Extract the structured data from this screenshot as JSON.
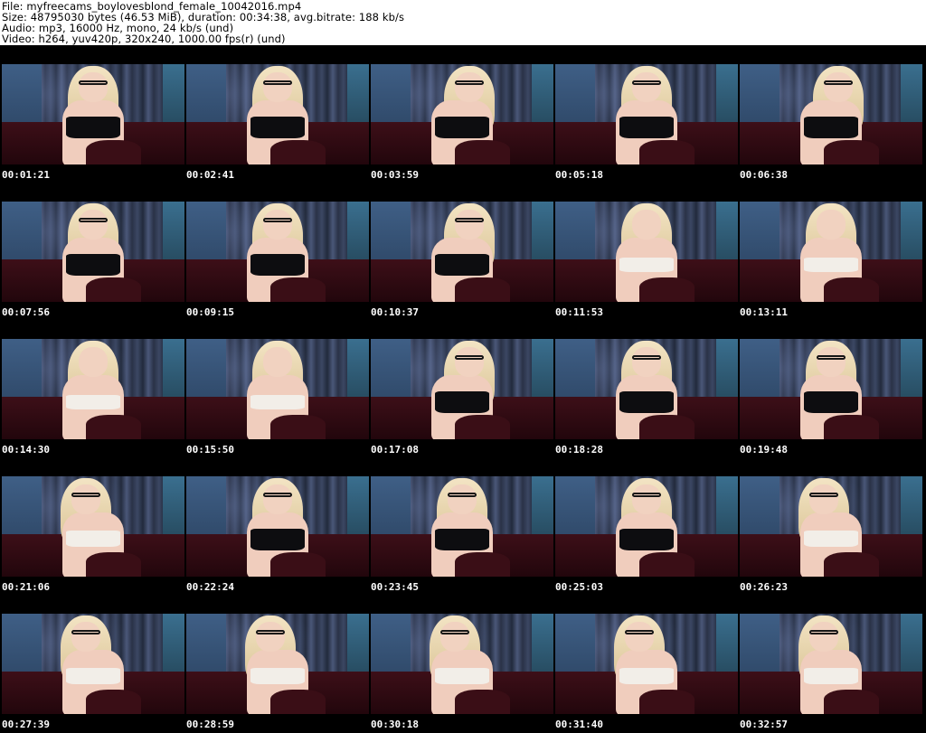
{
  "header": {
    "file_line": "File: myfreecams_boylovesblond_female_10042016.mp4",
    "size_line": "Size: 48795030 bytes (46.53 MiB), duration: 00:34:38, avg.bitrate: 188 kb/s",
    "audio_line": "Audio: mp3, 16000 Hz, mono, 24 kb/s (und)",
    "video_line": "Video: h264, yuv420p, 320x240, 1000.00 fps(r) (und)"
  },
  "frames": [
    {
      "timestamp": "00:01:21",
      "pose": "a"
    },
    {
      "timestamp": "00:02:41",
      "pose": "a"
    },
    {
      "timestamp": "00:03:59",
      "pose": "b"
    },
    {
      "timestamp": "00:05:18",
      "pose": "a"
    },
    {
      "timestamp": "00:06:38",
      "pose": "b"
    },
    {
      "timestamp": "00:07:56",
      "pose": "a"
    },
    {
      "timestamp": "00:09:15",
      "pose": "a"
    },
    {
      "timestamp": "00:10:37",
      "pose": "b"
    },
    {
      "timestamp": "00:11:53",
      "pose": "d"
    },
    {
      "timestamp": "00:13:11",
      "pose": "d"
    },
    {
      "timestamp": "00:14:30",
      "pose": "d"
    },
    {
      "timestamp": "00:15:50",
      "pose": "d"
    },
    {
      "timestamp": "00:17:08",
      "pose": "b"
    },
    {
      "timestamp": "00:18:28",
      "pose": "a"
    },
    {
      "timestamp": "00:19:48",
      "pose": "a"
    },
    {
      "timestamp": "00:21:06",
      "pose": "c"
    },
    {
      "timestamp": "00:22:24",
      "pose": "a"
    },
    {
      "timestamp": "00:23:45",
      "pose": "a"
    },
    {
      "timestamp": "00:25:03",
      "pose": "a"
    },
    {
      "timestamp": "00:26:23",
      "pose": "c"
    },
    {
      "timestamp": "00:27:39",
      "pose": "c"
    },
    {
      "timestamp": "00:28:59",
      "pose": "c"
    },
    {
      "timestamp": "00:30:18",
      "pose": "c"
    },
    {
      "timestamp": "00:31:40",
      "pose": "c"
    },
    {
      "timestamp": "00:32:57",
      "pose": "c"
    }
  ]
}
